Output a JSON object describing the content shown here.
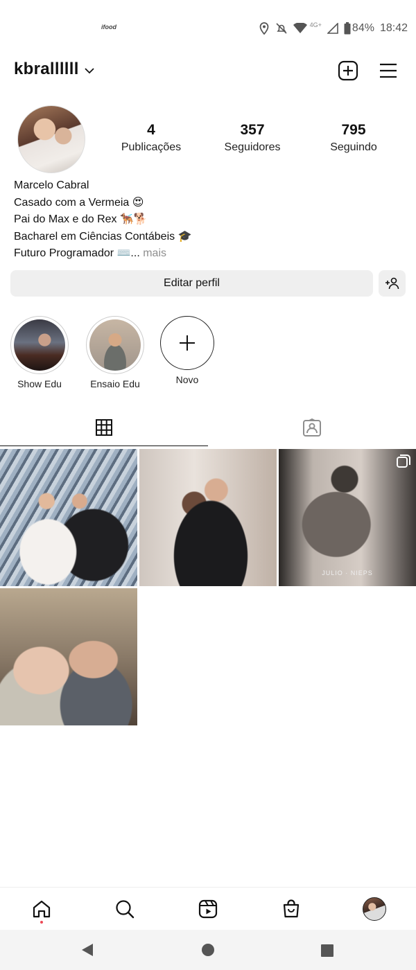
{
  "status_bar": {
    "app_logo": "ifood",
    "network": "4G+",
    "battery": "84%",
    "time": "18:42"
  },
  "header": {
    "username": "kbrallllll"
  },
  "profile": {
    "stats": [
      {
        "value": "4",
        "label": "Publicações"
      },
      {
        "value": "357",
        "label": "Seguidores"
      },
      {
        "value": "795",
        "label": "Seguindo"
      }
    ],
    "bio": {
      "name": "Marcelo Cabral",
      "lines": [
        "Casado com a Vermeia 😍",
        "Pai do Max e do Rex 🐕‍🦺🐕",
        "Bacharel em Ciências Contábeis 🎓"
      ],
      "last_line": "Futuro Programador ⌨️...",
      "more_label": " mais"
    },
    "edit_button": "Editar perfil"
  },
  "highlights": [
    {
      "label": "Show Edu"
    },
    {
      "label": "Ensaio Edu"
    },
    {
      "label": "Novo"
    }
  ],
  "posts": {
    "watermark": "JULIO · NIEPS"
  },
  "colors": {
    "accent_red": "#ed4956",
    "button_bg": "#efefef"
  }
}
